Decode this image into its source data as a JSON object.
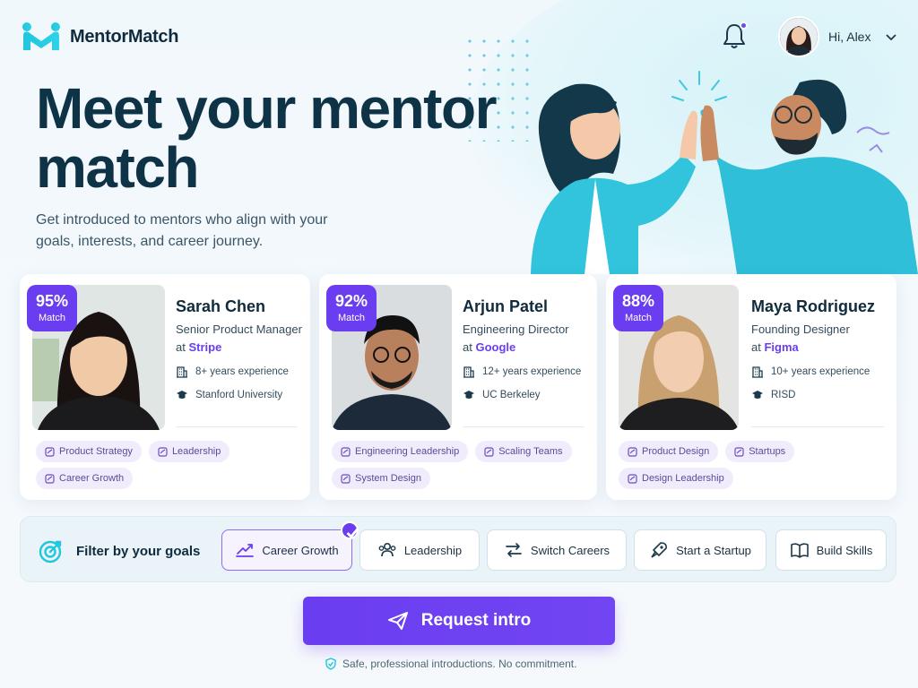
{
  "brand": {
    "name": "MentorMatch",
    "primary": "#6a3df0",
    "accent": "#1fc6de"
  },
  "header": {
    "notification_icon": "bell-icon",
    "user_greeting": "Hi, Alex"
  },
  "hero": {
    "title": "Meet your mentor match",
    "subtitle": "Get introduced to mentors who align with your goals, interests, and career journey."
  },
  "mentors": [
    {
      "match_pct": "95%",
      "match_label": "Match",
      "name": "Sarah Chen",
      "role": "Senior Product Manager",
      "at": "at",
      "company": "Stripe",
      "experience": "8+ years experience",
      "school": "Stanford University",
      "tags": [
        "Product Strategy",
        "Leadership",
        "Career Growth"
      ]
    },
    {
      "match_pct": "92%",
      "match_label": "Match",
      "name": "Arjun Patel",
      "role": "Engineering Director",
      "at": "at",
      "company": "Google",
      "experience": "12+ years experience",
      "school": "UC Berkeley",
      "tags": [
        "Engineering Leadership",
        "Scaling Teams",
        "System Design"
      ]
    },
    {
      "match_pct": "88%",
      "match_label": "Match",
      "name": "Maya Rodriguez",
      "role": "Founding Designer",
      "at": "at",
      "company": "Figma",
      "experience": "10+ years experience",
      "school": "RISD",
      "tags": [
        "Product Design",
        "Startups",
        "Design Leadership"
      ]
    }
  ],
  "filters": {
    "label": "Filter by your goals",
    "chips": [
      {
        "label": "Career Growth",
        "icon": "trend-up-icon",
        "selected": true
      },
      {
        "label": "Leadership",
        "icon": "users-icon",
        "selected": false
      },
      {
        "label": "Switch Careers",
        "icon": "swap-icon",
        "selected": false
      },
      {
        "label": "Start a Startup",
        "icon": "rocket-icon",
        "selected": false
      },
      {
        "label": "Build Skills",
        "icon": "book-icon",
        "selected": false
      }
    ]
  },
  "cta": {
    "label": "Request intro",
    "note": "Safe, professional introductions. No commitment."
  }
}
